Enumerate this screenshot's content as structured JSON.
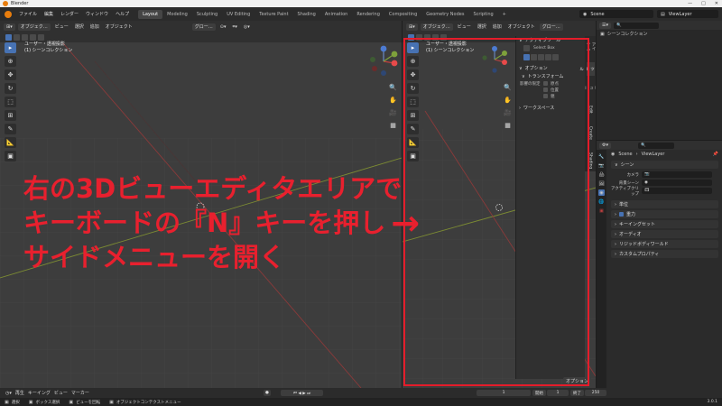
{
  "titlebar": {
    "title": "Blender",
    "min": "—",
    "max": "□",
    "close": "✕"
  },
  "menu": {
    "items": [
      "ファイル",
      "編集",
      "レンダー",
      "ウィンドウ",
      "ヘルプ"
    ]
  },
  "workspaces": {
    "tabs": [
      "Layout",
      "Modeling",
      "Sculpting",
      "UV Editing",
      "Texture Paint",
      "Shading",
      "Animation",
      "Rendering",
      "Compositing",
      "Geometry Nodes",
      "Scripting"
    ],
    "active": "Layout",
    "add": "+"
  },
  "scene": {
    "name": "Scene",
    "viewlayer": "ViewLayer"
  },
  "left_viewport": {
    "header": {
      "mode": "オブジェク…",
      "view": "ビュー",
      "select": "選択",
      "add": "追加",
      "object": "オブジェクト",
      "transform": "グロー…"
    },
    "overlay_line1": "ユーザー・透視投影",
    "overlay_line2": "(1) シーンコレクション"
  },
  "right_viewport": {
    "header": {
      "mode": "オブジェク…",
      "view": "ビュー",
      "select": "選択",
      "add": "追加",
      "object": "オブジェクト",
      "transform": "グロー…"
    },
    "overlay_line1": "ユーザー・透視投影",
    "overlay_line2": "(1) シーンコレクション",
    "options_btn": "オプション"
  },
  "npanel": {
    "active_tool_title": "アクティブツール",
    "select_box": "Select Box",
    "options_title": "オプション",
    "transform_title": "トランスフォーム",
    "affect_only": "影響の限定",
    "origins": "原点",
    "locations": "位置",
    "parents": "親",
    "workspace_title": "ワークスペース",
    "tabs": [
      "アイテム",
      "ツール",
      "ビュー",
      "Edit",
      "Create",
      "Shading"
    ],
    "active_tab": "ツール"
  },
  "outliner": {
    "root": "シーンコレクション"
  },
  "properties": {
    "breadcrumb_scene": "Scene",
    "breadcrumb_layer": "ViewLayer",
    "scene_title": "シーン",
    "camera_label": "カメラ",
    "bg_scene_label": "背景シーン",
    "active_clip_label": "アクティブクリップ",
    "sections": [
      "単位",
      "重力",
      "キーイングセット",
      "オーディオ",
      "リジッドボディワールド",
      "カスタムプロパティ"
    ],
    "gravity_checked": true
  },
  "timeline": {
    "playback": "再生",
    "keying": "キーイング",
    "view": "ビュー",
    "marker": "マーカー",
    "current_frame": "1",
    "start_label": "開始",
    "start": "1",
    "end_label": "終了",
    "end": "250"
  },
  "statusbar": {
    "select": "選択",
    "box_select": "ボックス選択",
    "rotate_view": "ビューを回転",
    "context_menu": "オブジェクトコンテクストメニュー",
    "version": "3.0.1"
  },
  "annotation": {
    "line1": "右の3Dビューエディタエリアで",
    "line2": "キーボードの『N』キーを押し",
    "line3": "サイドメニューを開く",
    "arrow": "→",
    "color": "#e8202e"
  },
  "colors": {
    "accent": "#4772b3",
    "brand": "#e87d0d",
    "highlight_red": "#e51c2a"
  }
}
